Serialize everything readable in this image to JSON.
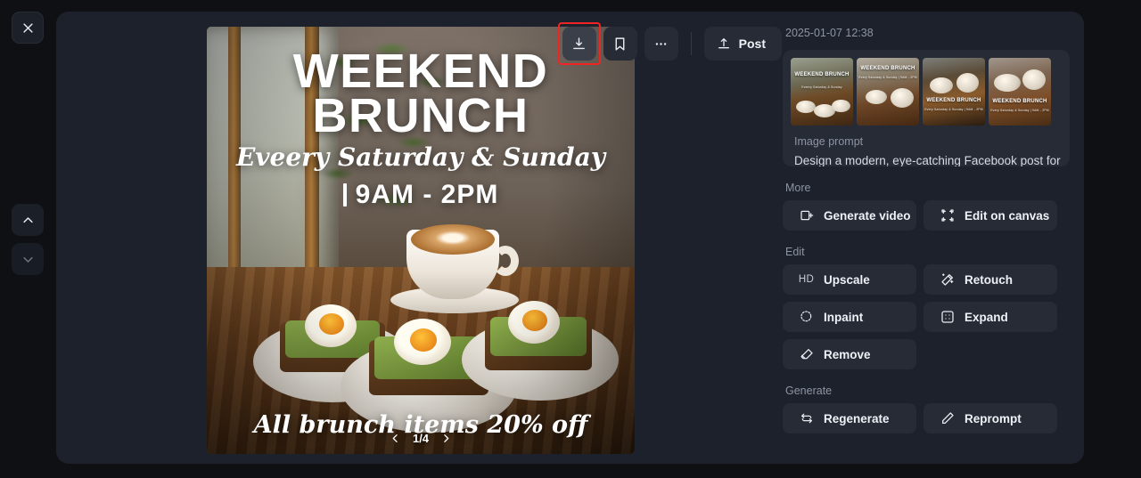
{
  "rail": {
    "close_icon": "close-icon",
    "prev_icon": "chevron-up-icon",
    "next_icon": "chevron-down-icon"
  },
  "toolbar": {
    "download_icon": "download-icon",
    "bookmark_icon": "bookmark-icon",
    "more_icon": "more-horizontal-icon",
    "post_label": "Post",
    "post_icon": "upload-icon",
    "highlight_color": "#f02424"
  },
  "preview": {
    "poster": {
      "headline_line1": "WEEKEND",
      "headline_line2": "BRUNCH",
      "script_line": "Eveery Saturday & Sunday",
      "hours": "9AM - 2PM",
      "footer": "All brunch items 20% off"
    },
    "pager": {
      "prev_icon": "chevron-left-icon",
      "next_icon": "chevron-right-icon",
      "counter": "1/4"
    }
  },
  "sidebar": {
    "timestamp": "2025-01-07 12:38",
    "thumbnails": [
      {
        "name": "thumbnail-1",
        "title": "WEEKEND BRUNCH",
        "subtitle": "Eveery Saturday & Sunday"
      },
      {
        "name": "thumbnail-2",
        "title": "WEEKEND BRUNCH",
        "subtitle": "Every Saturday & Sunday | 9AM - 2PM"
      },
      {
        "name": "thumbnail-3",
        "title": "WEEKEND BRUNCH",
        "subtitle": "Every Saturday & Sunday | 9AM - 2PM"
      },
      {
        "name": "thumbnail-4",
        "title": "WEEKEND BRUNCH",
        "subtitle": "Every Saturday & Sunday | 9AM - 2PM"
      }
    ],
    "prompt_label": "Image prompt",
    "prompt_text": "Design a modern, eye-catching Facebook post for",
    "sections": [
      {
        "title": "More",
        "actions": [
          {
            "label": "Generate video",
            "icon": "video-frame-icon",
            "name": "generate-video-button"
          },
          {
            "label": "Edit on canvas",
            "icon": "canvas-transform-icon",
            "name": "edit-on-canvas-button"
          }
        ]
      },
      {
        "title": "Edit",
        "actions": [
          {
            "label": "Upscale",
            "icon": "hd-icon",
            "name": "upscale-button"
          },
          {
            "label": "Retouch",
            "icon": "magic-wand-icon",
            "name": "retouch-button"
          },
          {
            "label": "Inpaint",
            "icon": "inpaint-brush-icon",
            "name": "inpaint-button"
          },
          {
            "label": "Expand",
            "icon": "expand-box-icon",
            "name": "expand-button"
          },
          {
            "label": "Remove",
            "icon": "eraser-icon",
            "name": "remove-button"
          }
        ]
      },
      {
        "title": "Generate",
        "actions": [
          {
            "label": "Regenerate",
            "icon": "refresh-icon",
            "name": "regenerate-button"
          },
          {
            "label": "Reprompt",
            "icon": "pencil-icon",
            "name": "reprompt-button"
          }
        ]
      }
    ]
  }
}
